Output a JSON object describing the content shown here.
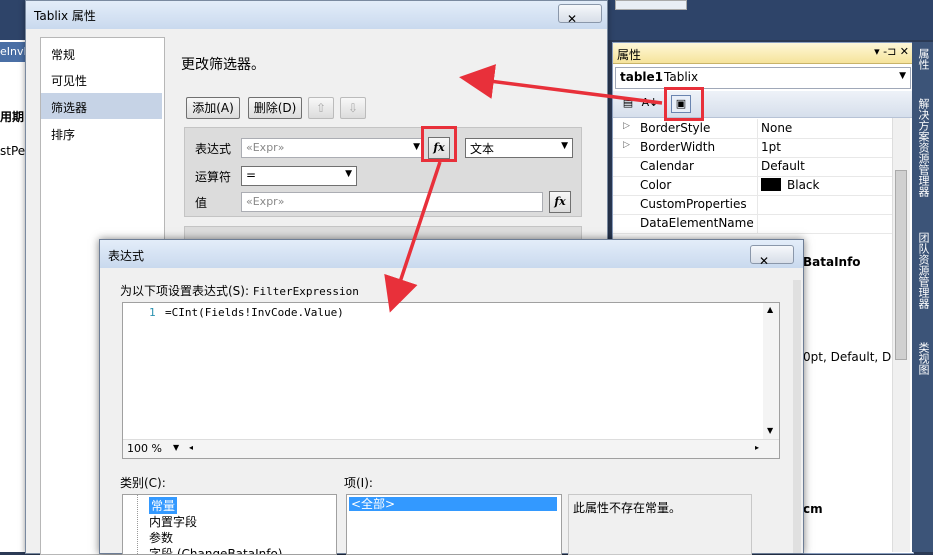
{
  "background": {
    "doc_tab": "eInvF",
    "doc_text_1": "用期",
    "doc_text_2": "stPe"
  },
  "properties": {
    "title": "属性",
    "title_buttons": "▾ ‑⊐ ✕",
    "object_name": "table1",
    "object_type": "Tablix",
    "rows": [
      {
        "expand": "▷",
        "key": "BorderStyle",
        "value": "None"
      },
      {
        "expand": "▷",
        "key": "BorderWidth",
        "value": "1pt"
      },
      {
        "expand": "",
        "key": "Calendar",
        "value": "Default"
      },
      {
        "expand": "",
        "key": "Color",
        "value": "Black"
      },
      {
        "expand": "",
        "key": "CustomProperties",
        "value": ""
      },
      {
        "expand": "",
        "key": "DataElementName",
        "value": ""
      }
    ],
    "partial_values": {
      "row1": "BataInfo",
      "row2": "0pt, Default, De",
      "row3": "cm"
    }
  },
  "side_strip": {
    "tabs": [
      "属性",
      "解决方案资源管理器",
      "团队资源管理器",
      "类视图"
    ]
  },
  "tablix_dialog": {
    "title": "Tablix 属性",
    "nav": [
      "常规",
      "可见性",
      "筛选器",
      "排序"
    ],
    "selected_nav": "筛选器",
    "section_title": "更改筛选器。",
    "add_button": "添加(A)",
    "delete_button": "删除(D)",
    "expr_label": "表达式",
    "expr_placeholder": "«Expr»",
    "type_value": "文本",
    "operator_label": "运算符",
    "operator_value": "=",
    "value_label": "值",
    "value_placeholder": "«Expr»",
    "fx": "fx"
  },
  "expression_dialog": {
    "title": "表达式",
    "set_label": "为以下项设置表达式(S):",
    "set_target": "FilterExpression",
    "line_number": "1",
    "code": "=CInt(Fields!InvCode.Value)",
    "zoom": "100 %",
    "category_label": "类别(C):",
    "item_label": "项(I):",
    "categories": [
      "常量",
      "内置字段",
      "参数",
      "字段 (ChangeBataInfo)"
    ],
    "items": [
      "<全部>"
    ],
    "description": "此属性不存在常量。"
  },
  "colors": {
    "highlight": "#e8303a",
    "selection": "#3399ff"
  }
}
